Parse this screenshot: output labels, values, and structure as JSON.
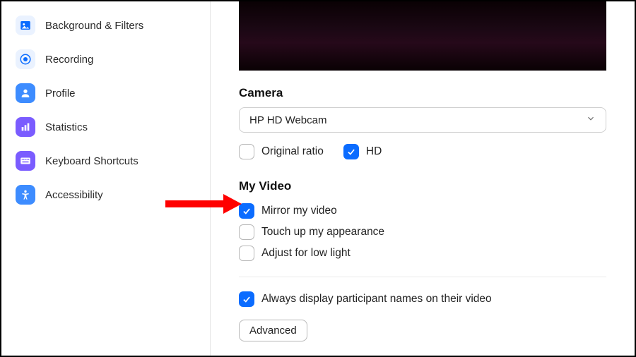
{
  "sidebar": {
    "items": [
      {
        "label": "Background & Filters",
        "icon": "image-icon"
      },
      {
        "label": "Recording",
        "icon": "record-icon"
      },
      {
        "label": "Profile",
        "icon": "profile-icon"
      },
      {
        "label": "Statistics",
        "icon": "stats-icon"
      },
      {
        "label": "Keyboard Shortcuts",
        "icon": "keyboard-icon"
      },
      {
        "label": "Accessibility",
        "icon": "accessibility-icon"
      }
    ]
  },
  "camera": {
    "heading": "Camera",
    "selected": "HP HD Webcam",
    "options": [
      {
        "label": "Original ratio",
        "checked": false
      },
      {
        "label": "HD",
        "checked": true
      }
    ]
  },
  "my_video": {
    "heading": "My Video",
    "options": [
      {
        "label": "Mirror my video",
        "checked": true
      },
      {
        "label": "Touch up my appearance",
        "checked": false
      },
      {
        "label": "Adjust for low light",
        "checked": false
      }
    ]
  },
  "misc": {
    "always_display_names": {
      "label": "Always display participant names on their video",
      "checked": true
    },
    "advanced_label": "Advanced"
  },
  "colors": {
    "accent": "#0b6cff",
    "sidebar_icon_bg": "#3d8cff"
  }
}
